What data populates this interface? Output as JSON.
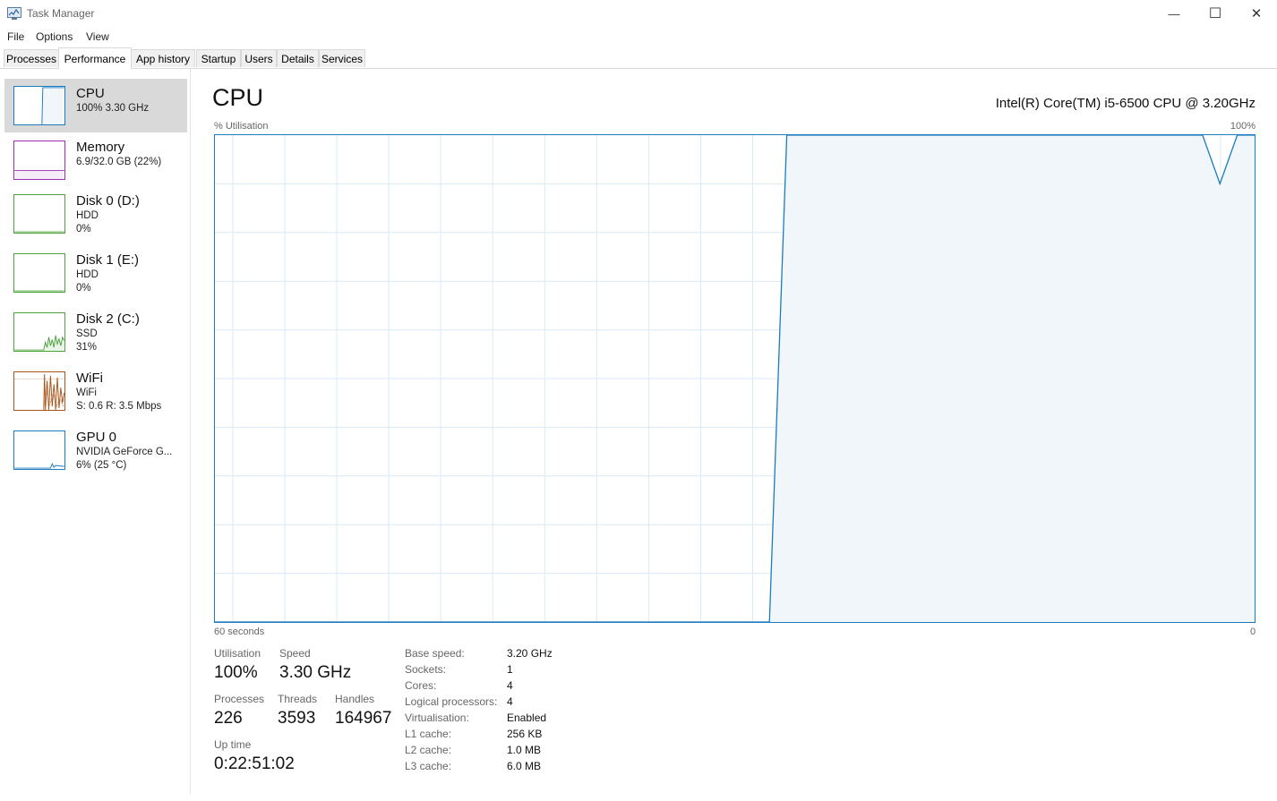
{
  "window": {
    "title": "Task Manager",
    "minimize_glyph": "—",
    "maximize_glyph": "☐",
    "close_glyph": "✕"
  },
  "menu": [
    "File",
    "Options",
    "View"
  ],
  "tabs": [
    "Processes",
    "Performance",
    "App history",
    "Startup",
    "Users",
    "Details",
    "Services"
  ],
  "active_tab": "Performance",
  "sidebar": [
    {
      "name": "CPU",
      "line1": "100% 3.30 GHz",
      "line2": "",
      "color": "#1c7bbf",
      "icon": "cpu-graph-icon"
    },
    {
      "name": "Memory",
      "line1": "6.9/32.0 GB (22%)",
      "line2": "",
      "color": "#9b2fae",
      "icon": "memory-graph-icon"
    },
    {
      "name": "Disk 0 (D:)",
      "line1": "HDD",
      "line2": "0%",
      "color": "#4da13c",
      "icon": "disk-graph-icon"
    },
    {
      "name": "Disk 1 (E:)",
      "line1": "HDD",
      "line2": "0%",
      "color": "#4da13c",
      "icon": "disk-graph-icon"
    },
    {
      "name": "Disk 2 (C:)",
      "line1": "SSD",
      "line2": "31%",
      "color": "#4da13c",
      "icon": "disk-graph-icon"
    },
    {
      "name": "WiFi",
      "line1": "WiFi",
      "line2": "S: 0.6 R: 3.5 Mbps",
      "color": "#a7561b",
      "icon": "wifi-graph-icon"
    },
    {
      "name": "GPU 0",
      "line1": "NVIDIA GeForce G...",
      "line2": "6% (25 °C)",
      "color": "#1c7bbf",
      "icon": "gpu-graph-icon"
    }
  ],
  "main": {
    "title": "CPU",
    "model": "Intel(R) Core(TM) i5-6500 CPU @ 3.20GHz",
    "y_label": "% Utilisation",
    "y_max": "100%",
    "x_left": "60 seconds",
    "x_right": "0"
  },
  "chart_data": {
    "type": "area",
    "x": [
      60,
      59,
      58,
      57,
      56,
      55,
      54,
      53,
      52,
      51,
      50,
      49,
      48,
      47,
      46,
      45,
      44,
      43,
      42,
      41,
      40,
      39,
      38,
      37,
      36,
      35,
      34,
      33,
      32,
      31,
      30,
      29,
      28,
      27,
      26,
      25,
      24,
      23,
      22,
      21,
      20,
      19,
      18,
      17,
      16,
      15,
      14,
      13,
      12,
      11,
      10,
      9,
      8,
      7,
      6,
      5,
      4,
      3,
      2,
      1,
      0
    ],
    "series": [
      {
        "values": [
          0,
          0,
          0,
          0,
          0,
          0,
          0,
          0,
          0,
          0,
          0,
          0,
          0,
          0,
          0,
          0,
          0,
          0,
          0,
          0,
          0,
          0,
          0,
          0,
          0,
          0,
          0,
          0,
          0,
          0,
          0,
          0,
          0,
          100,
          100,
          100,
          100,
          100,
          100,
          100,
          100,
          100,
          100,
          100,
          100,
          100,
          100,
          100,
          100,
          100,
          100,
          100,
          100,
          100,
          100,
          100,
          100,
          100,
          90,
          100,
          100
        ]
      }
    ],
    "xlabel": "60 seconds",
    "ylabel": "% Utilisation",
    "ylim": [
      0,
      100
    ],
    "grid": true,
    "line_color": "#1c7bbf",
    "fill_color": "#f1f6fa"
  },
  "stats": {
    "utilisation_label": "Utilisation",
    "utilisation": "100%",
    "speed_label": "Speed",
    "speed": "3.30 GHz",
    "processes_label": "Processes",
    "processes": "226",
    "threads_label": "Threads",
    "threads": "3593",
    "handles_label": "Handles",
    "handles": "164967",
    "uptime_label": "Up time",
    "uptime": "0:22:51:02"
  },
  "info": [
    {
      "key": "Base speed:",
      "value": "3.20 GHz"
    },
    {
      "key": "Sockets:",
      "value": "1"
    },
    {
      "key": "Cores:",
      "value": "4"
    },
    {
      "key": "Logical processors:",
      "value": "4"
    },
    {
      "key": "Virtualisation:",
      "value": "Enabled"
    },
    {
      "key": "L1 cache:",
      "value": "256 KB"
    },
    {
      "key": "L2 cache:",
      "value": "1.0 MB"
    },
    {
      "key": "L3 cache:",
      "value": "6.0 MB"
    }
  ]
}
